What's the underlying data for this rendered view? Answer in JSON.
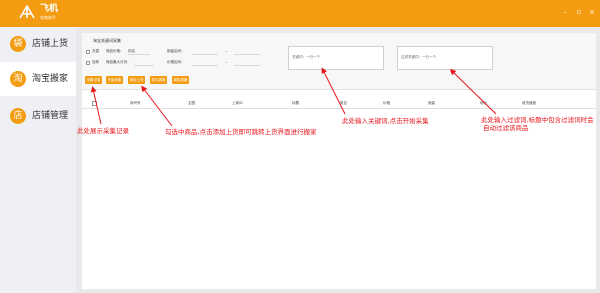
{
  "app": {
    "brand": "飞机",
    "brand_sub": "电商助手",
    "accent": "#f39c12",
    "window_controls": [
      "–",
      "▫",
      "×"
    ]
  },
  "sidebar": {
    "items": [
      {
        "label": "店铺上货",
        "icon": "bag-icon",
        "glyph": "袋",
        "active": false
      },
      {
        "label": "淘宝搬家",
        "icon": "taobao-icon",
        "glyph": "淘",
        "active": true
      },
      {
        "label": "店铺管理",
        "icon": "store-icon",
        "glyph": "店",
        "active": false
      }
    ]
  },
  "panel": {
    "title": "淘宝关键词采集",
    "row1": {
      "check_label": "天猫",
      "price_label": "商品价格：",
      "price_value": "销量",
      "sales_label": "销量区间：",
      "dash": "--"
    },
    "row2": {
      "check_label": "包邮",
      "collect_label": "商品最大分页：",
      "collect_value": "",
      "region_label": "价格区间：",
      "dash": "--"
    },
    "keyword_box": {
      "label": "关键词：一行一个"
    },
    "filter_box": {
      "label": "过滤关键词：一行一个"
    },
    "buttons": [
      "采集记录",
      "开始采集",
      "添加上货",
      "导出表格",
      "清除表格"
    ]
  },
  "table": {
    "headers": [
      "序列号",
      "主图",
      "上架ID",
      "标题",
      "类目",
      "价格",
      "销量",
      "地址",
      "收货速度"
    ]
  },
  "annotations": [
    "此处展示采集记录",
    "勾选中商品,点击添加上货即可跳转上货界面进行搬家",
    "此处输入关键词,点击开始采集",
    "此处输入过滤词,标题中包含过滤词时会",
    "自动过滤该商品"
  ]
}
